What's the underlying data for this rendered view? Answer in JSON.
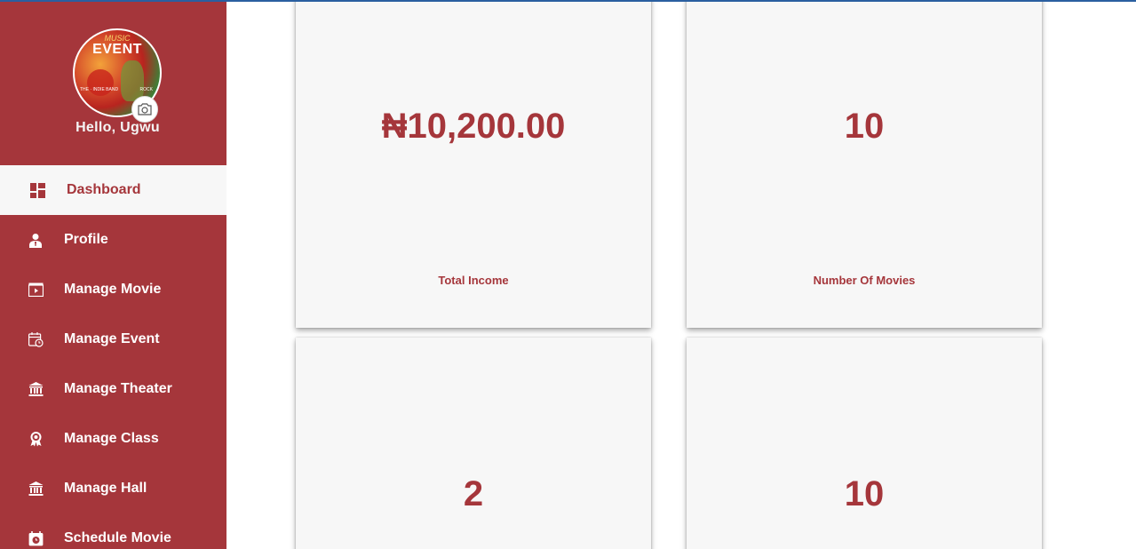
{
  "sidebar": {
    "greeting": "Hello, Ugwu",
    "avatar": {
      "line1": "MUSIC",
      "line2": "EVENT",
      "tag_left": "THE · INDIE BAND",
      "tag_right": "ROCK"
    },
    "items": [
      {
        "label": "Dashboard",
        "icon": "dashboard-icon",
        "active": true
      },
      {
        "label": "Profile",
        "icon": "user-icon"
      },
      {
        "label": "Manage Movie",
        "icon": "movie-icon"
      },
      {
        "label": "Manage Event",
        "icon": "event-icon"
      },
      {
        "label": "Manage Theater",
        "icon": "theater-icon"
      },
      {
        "label": "Manage Class",
        "icon": "award-icon"
      },
      {
        "label": "Manage Hall",
        "icon": "hall-icon"
      },
      {
        "label": "Schedule Movie",
        "icon": "schedule-icon"
      }
    ]
  },
  "cards": [
    {
      "value": "₦10,200.00",
      "caption": "Total Income"
    },
    {
      "value": "10",
      "caption": "Number Of Movies"
    },
    {
      "value": "2",
      "caption": ""
    },
    {
      "value": "10",
      "caption": ""
    }
  ],
  "colors": {
    "primary": "#a5363b",
    "card_bg": "#f7f7f7",
    "top_line": "#2a5fa0"
  }
}
